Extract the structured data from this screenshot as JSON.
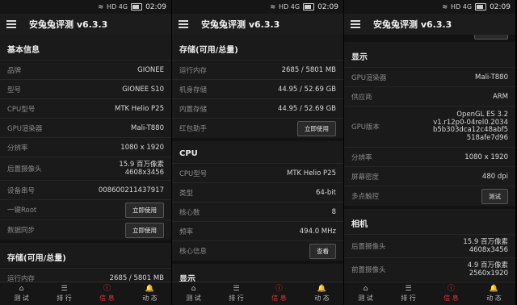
{
  "status": {
    "time": "02:09",
    "signal": "HD 4G"
  },
  "app": {
    "title": "安兔兔评测 v6.3.3"
  },
  "nav": [
    {
      "icon": "home-icon",
      "glyph": "⌂",
      "label": "测 试"
    },
    {
      "icon": "list-icon",
      "glyph": "☰",
      "label": "排 行"
    },
    {
      "icon": "info-icon",
      "glyph": "ⓘ",
      "label": "信 息"
    },
    {
      "icon": "bell-icon",
      "glyph": "🔔",
      "label": "动 态"
    }
  ],
  "accent": "#d93b3b",
  "panel1": {
    "basic": {
      "title": "基本信息",
      "rows": [
        {
          "k": "品牌",
          "v": "GIONEE"
        },
        {
          "k": "型号",
          "v": "GIONEE S10"
        },
        {
          "k": "CPU型号",
          "v": "MTK Helio P25"
        },
        {
          "k": "GPU渲染器",
          "v": "Mali-T880"
        },
        {
          "k": "分辨率",
          "v": "1080 x 1920"
        },
        {
          "k": "后置摄像头",
          "v1": "15.9 百万像素",
          "v2": "4608x3456"
        },
        {
          "k": "设备串号",
          "v": "008600211437917"
        },
        {
          "k": "一键Root",
          "btn": "立即使用"
        },
        {
          "k": "数据同步",
          "btn": "立即使用"
        }
      ]
    },
    "storage": {
      "title": "存储(可用/总量)",
      "rows": [
        {
          "k": "运行内存",
          "v": "2685 / 5801 MB"
        }
      ]
    }
  },
  "panel2": {
    "storage": {
      "title": "存储(可用/总量)",
      "rows": [
        {
          "k": "运行内存",
          "v": "2685 / 5801 MB"
        },
        {
          "k": "机身存储",
          "v": "44.95 / 52.69 GB"
        },
        {
          "k": "内置存储",
          "v": "44.95 / 52.69 GB"
        },
        {
          "k": "红包助手",
          "btn": "立即使用"
        }
      ]
    },
    "cpu": {
      "title": "CPU",
      "rows": [
        {
          "k": "CPU型号",
          "v": "MTK Helio P25"
        },
        {
          "k": "类型",
          "v": "64-bit"
        },
        {
          "k": "核心数",
          "v": "8"
        },
        {
          "k": "频率",
          "v": "494.0 MHz"
        },
        {
          "k": "核心信息",
          "btn": "查看"
        }
      ]
    },
    "display": {
      "title": "显示"
    }
  },
  "panel3": {
    "display": {
      "title": "显示",
      "rows": [
        {
          "k": "GPU渲染器",
          "v": "Mali-T880"
        },
        {
          "k": "供应商",
          "v": "ARM"
        },
        {
          "k": "GPU版本",
          "vlines": [
            "OpenGL ES 3.2",
            "v1.r12p0-04rel0.2034",
            "b5b303dca12c48abf5",
            "518afe7d96"
          ]
        },
        {
          "k": "分辨率",
          "v": "1080 x 1920"
        },
        {
          "k": "屏幕密度",
          "v": "480 dpi"
        },
        {
          "k": "多点触控",
          "btn": "测试"
        }
      ]
    },
    "camera": {
      "title": "相机",
      "rows": [
        {
          "k": "后置摄像头",
          "v1": "15.9 百万像素",
          "v2": "4608x3456"
        },
        {
          "k": "前置摄像头",
          "v1": "4.9 百万像素",
          "v2": "2560x1920"
        }
      ]
    }
  }
}
